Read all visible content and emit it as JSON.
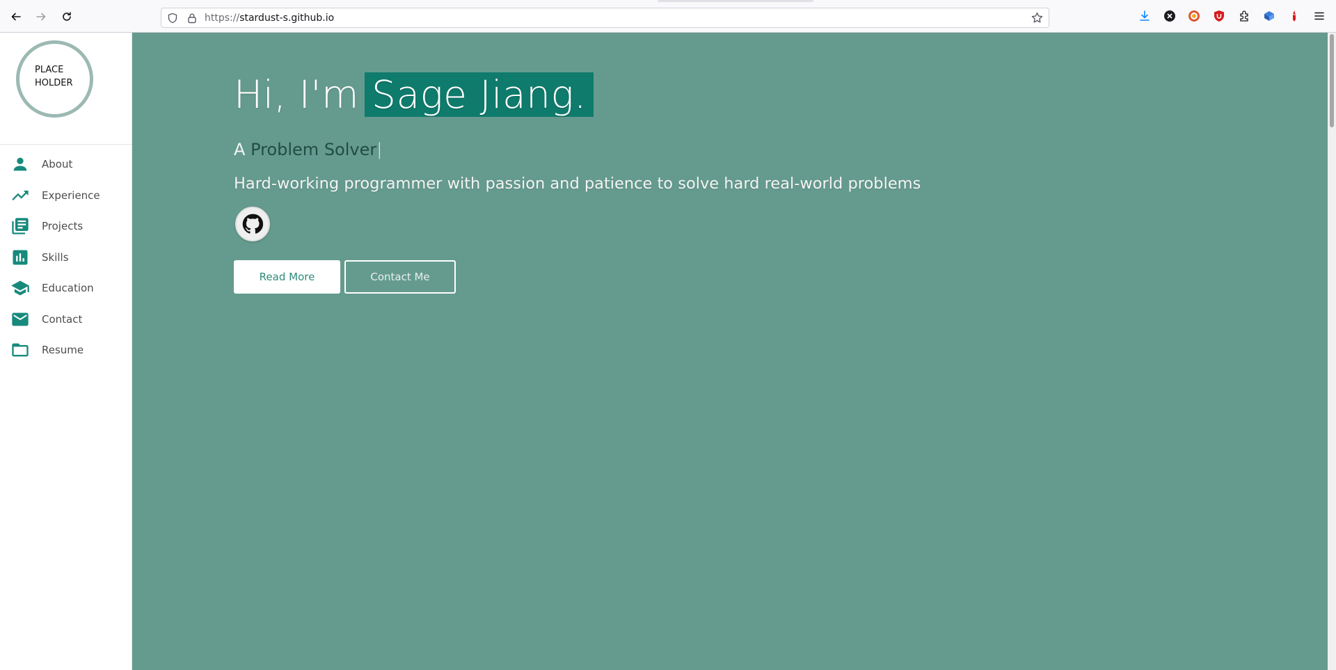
{
  "browser": {
    "url_protocol": "https://",
    "url_host": "stardust-s.github.io",
    "icons": [
      "back-icon",
      "forward-icon",
      "reload-icon",
      "shield-icon",
      "lock-icon",
      "bookmark-star-icon",
      "download-icon",
      "x-extension-icon",
      "duckduckgo-icon",
      "ublock-icon",
      "extensions-icon",
      "bitwarden-icon",
      "pen-icon",
      "menu-icon"
    ]
  },
  "sidebar": {
    "avatar_text": "PLACE\nHOLDER",
    "items": [
      {
        "label": "About",
        "icon": "person-icon"
      },
      {
        "label": "Experience",
        "icon": "trending-up-icon"
      },
      {
        "label": "Projects",
        "icon": "library-books-icon"
      },
      {
        "label": "Skills",
        "icon": "bar-chart-icon"
      },
      {
        "label": "Education",
        "icon": "graduation-cap-icon"
      },
      {
        "label": "Contact",
        "icon": "mail-icon"
      },
      {
        "label": "Resume",
        "icon": "folder-icon"
      }
    ]
  },
  "hero": {
    "greeting": "Hi, I'm",
    "name": "Sage Jiang.",
    "subtitle_prefix": "A",
    "role": "Problem Solver",
    "cursor": "|",
    "tagline": "Hard-working programmer with passion and patience to solve hard real-world problems",
    "read_more": "Read More",
    "contact_me": "Contact Me"
  },
  "colors": {
    "hero_bg": "#659b8e",
    "accent": "#178a7c",
    "name_highlight": "#0f7b6c"
  }
}
